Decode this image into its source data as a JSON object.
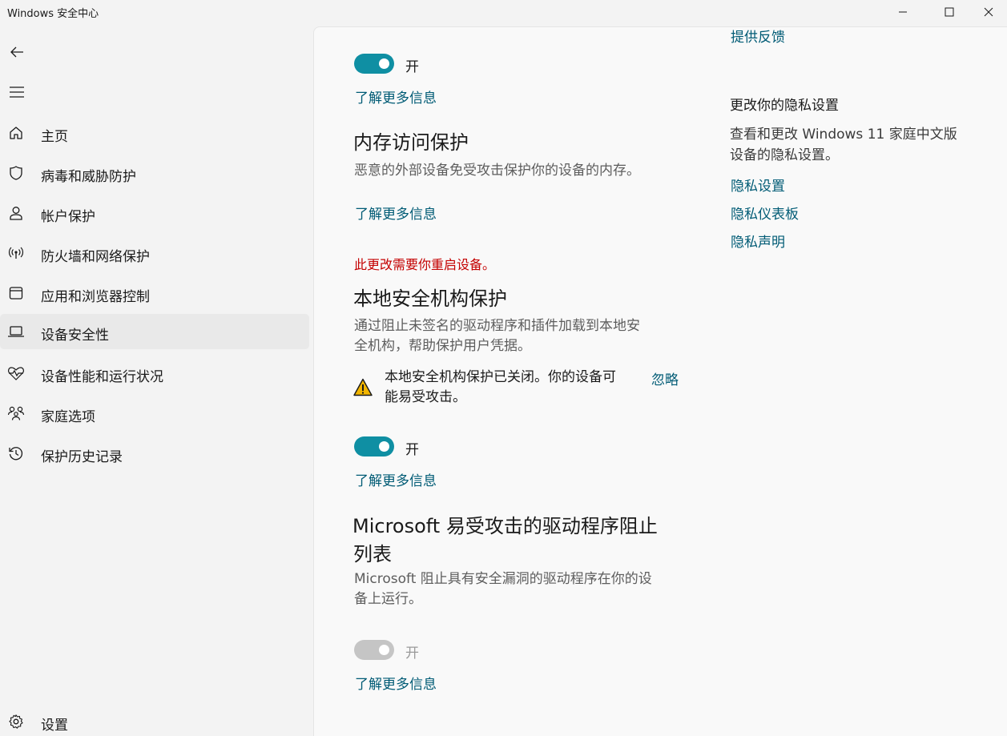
{
  "window": {
    "title": "Windows 安全中心"
  },
  "sidebar": {
    "items": [
      {
        "label": "主页",
        "icon": "home-icon"
      },
      {
        "label": "病毒和威胁防护",
        "icon": "shield-icon"
      },
      {
        "label": "帐户保护",
        "icon": "person-icon"
      },
      {
        "label": "防火墙和网络保护",
        "icon": "antenna-icon"
      },
      {
        "label": "应用和浏览器控制",
        "icon": "app-window-icon"
      },
      {
        "label": "设备安全性",
        "icon": "laptop-icon",
        "selected": true
      },
      {
        "label": "设备性能和运行状况",
        "icon": "heartbeat-icon"
      },
      {
        "label": "家庭选项",
        "icon": "family-icon"
      },
      {
        "label": "保护历史记录",
        "icon": "history-icon"
      }
    ],
    "settings_label": "设置"
  },
  "main": {
    "top_toggle_label": "开",
    "top_learn_more": "了解更多信息",
    "memory": {
      "title": "内存访问保护",
      "description": "恶意的外部设备免受攻击保护你的设备的内存。",
      "learn_more": "了解更多信息"
    },
    "lsa": {
      "restart_notice": "此更改需要你重启设备。",
      "title": "本地安全机构保护",
      "description_line1": "通过阻止未签名的驱动程序和插件加载到本地安",
      "description_line2": "全机构，帮助保护用户凭据。",
      "warning_line1": "本地安全机构保护已关闭。你的设备可",
      "warning_line2": "能易受攻击。",
      "dismiss_label": "忽略",
      "toggle_label": "开",
      "learn_more": "了解更多信息"
    },
    "blocklist": {
      "title_line1": "Microsoft 易受攻击的驱动程序阻止",
      "title_line2": "列表",
      "description_line1": "Microsoft 阻止具有安全漏洞的驱动程序在你的设",
      "description_line2": "备上运行。",
      "toggle_label": "开",
      "learn_more": "了解更多信息"
    }
  },
  "side_panel": {
    "feedback_link": "提供反馈",
    "privacy_heading": "更改你的隐私设置",
    "privacy_desc_line1": "查看和更改 Windows 11 家庭中文版",
    "privacy_desc_line2": "设备的隐私设置。",
    "links": [
      "隐私设置",
      "隐私仪表板",
      "隐私声明"
    ]
  },
  "colors": {
    "accent": "#0f8fa3",
    "link": "#005b75",
    "warning_red": "#c40000",
    "warning_yellow": "#f2b500"
  }
}
